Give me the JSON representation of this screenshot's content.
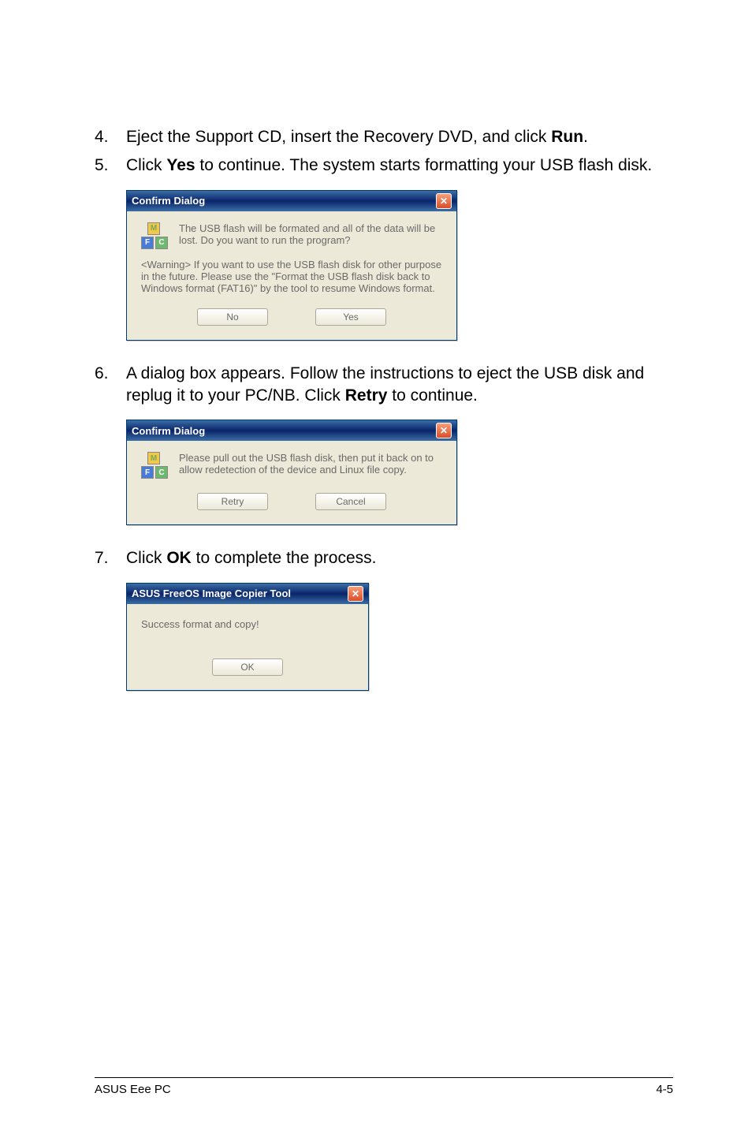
{
  "steps": {
    "s4": {
      "num": "4.",
      "text_before": "Eject the Support CD, insert the Recovery DVD, and click ",
      "bold": "Run",
      "text_after": "."
    },
    "s5": {
      "num": "5.",
      "text_before": "Click ",
      "bold": "Yes",
      "text_after": " to continue. The system starts formatting your USB flash disk."
    },
    "s6": {
      "num": "6.",
      "text_before": "A dialog box appears. Follow the instructions to eject the USB disk and replug it to your PC/NB. Click ",
      "bold": "Retry",
      "text_after": " to continue."
    },
    "s7": {
      "num": "7.",
      "text_before": "Click ",
      "bold": "OK",
      "text_after": " to complete the process."
    }
  },
  "dialog1": {
    "title": "Confirm Dialog",
    "msg": "The USB flash will be formated and all of the data will be lost. Do you want to run the program?",
    "warn": "<Warning> If you want to use the USB flash disk for other purpose in the future. Please use the \"Format the USB flash disk back to Windows format (FAT16)\" by the tool to resume Windows format.",
    "btn_no": "No",
    "btn_yes": "Yes"
  },
  "dialog2": {
    "title": "Confirm Dialog",
    "msg": "Please pull out the USB flash disk, then put it back on to allow redetection of the device and Linux file copy.",
    "btn_retry": "Retry",
    "btn_cancel": "Cancel"
  },
  "dialog3": {
    "title": "ASUS FreeOS Image Copier Tool",
    "msg": "Success format and copy!",
    "btn_ok": "OK"
  },
  "icon_labels": {
    "m": "M",
    "f": "F",
    "c": "C"
  },
  "close_glyph": "✕",
  "footer": {
    "left": "ASUS Eee PC",
    "right": "4-5"
  }
}
